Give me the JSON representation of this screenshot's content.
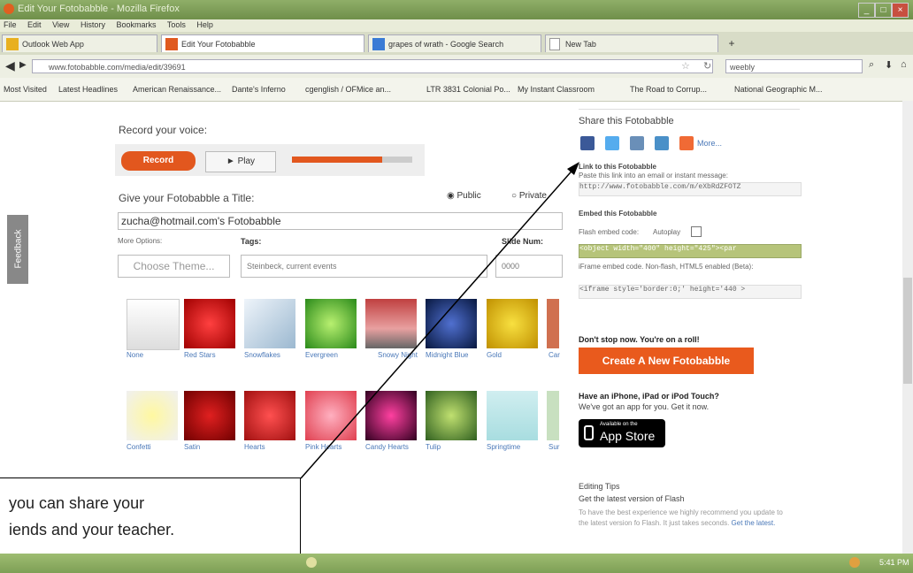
{
  "browser": {
    "window_title": "Edit Your Fotobabble - Mozilla Firefox",
    "menu": [
      "File",
      "Edit",
      "View",
      "History",
      "Bookmarks",
      "Tools",
      "Help"
    ],
    "tabs": [
      {
        "label": "Outlook Web App"
      },
      {
        "label": "Edit Your Fotobabble"
      },
      {
        "label": "grapes of wrath - Google Search"
      },
      {
        "label": "New Tab"
      }
    ],
    "new_tab": "+",
    "url": "www.fotobabble.com/media/edit/39691",
    "search_value": "weebly",
    "bookmarks": [
      "Most Visited",
      "Latest Headlines",
      "American Renaissance...",
      "Dante's Inferno",
      "cgenglish / OFMice an...",
      "LTR 3831 Colonial Po...",
      "My Instant Classroom",
      "The Road to Corrup...",
      "National Geographic M..."
    ]
  },
  "page": {
    "record_label": "Record your voice:",
    "record_button": "Record",
    "play_button": "► Play",
    "playback_progress": 0.75,
    "title_label": "Give your Fotobabble a Title:",
    "public_label": "Public",
    "private_label": "Private",
    "title_value": "zucha@hotmail.com's Fotobabble",
    "more_options": "More Options:",
    "tags_label": "Tags:",
    "slide_num_label": "Slide Num:",
    "choose_theme": "Choose Theme...",
    "tags_value": "Steinbeck, current events",
    "slide_num_value": "0000",
    "themes_row1": [
      "None",
      "Red Stars",
      "Snowflakes",
      "Evergreen",
      "Snowy Night",
      "Midnight Blue",
      "Gold",
      "Car"
    ],
    "themes_row2": [
      "Confetti",
      "Satin",
      "Hearts",
      "Pink Hearts",
      "Candy Hearts",
      "Tulip",
      "Springtime",
      "Sur"
    ],
    "feedback": "Feedback"
  },
  "sidebar": {
    "share_title": "Share this Fotobabble",
    "more": "More...",
    "link_title": "Link to this Fotobabble",
    "link_help": "Paste this link into an email or instant message:",
    "link_value": "http://www.fotobabble.com/m/eXbRdZFOTZ",
    "embed_title": "Embed this Fotobabble",
    "flash_label": "Flash embed code:",
    "autoplay_label": "Autoplay",
    "flash_value": "<object width=\"400\" height=\"425\"><par",
    "iframe_label": "iFrame embed code. Non-flash, HTML5 enabled (Beta):",
    "iframe_value": "<iframe style='border:0;' height='440 >",
    "dont_stop": "Don't stop now. You're on a roll!",
    "create_button": "Create A New Fotobabble",
    "iphone_title": "Have an iPhone, iPad or iPod Touch?",
    "iphone_text": "We've got an app for you. Get it now.",
    "appstore_small": "Available on the",
    "appstore_big": "App Store",
    "tips_title": "Editing Tips",
    "tips_sub": "Get the latest version of Flash",
    "tips_text": "To have the best experience we highly recommend you update to the latest version fo Flash. It just takes seconds.",
    "tips_link": "Get the latest."
  },
  "callout": {
    "line1": "you can share your",
    "line2": "iends and your teacher."
  },
  "status": {
    "time": "5:41 PM"
  }
}
